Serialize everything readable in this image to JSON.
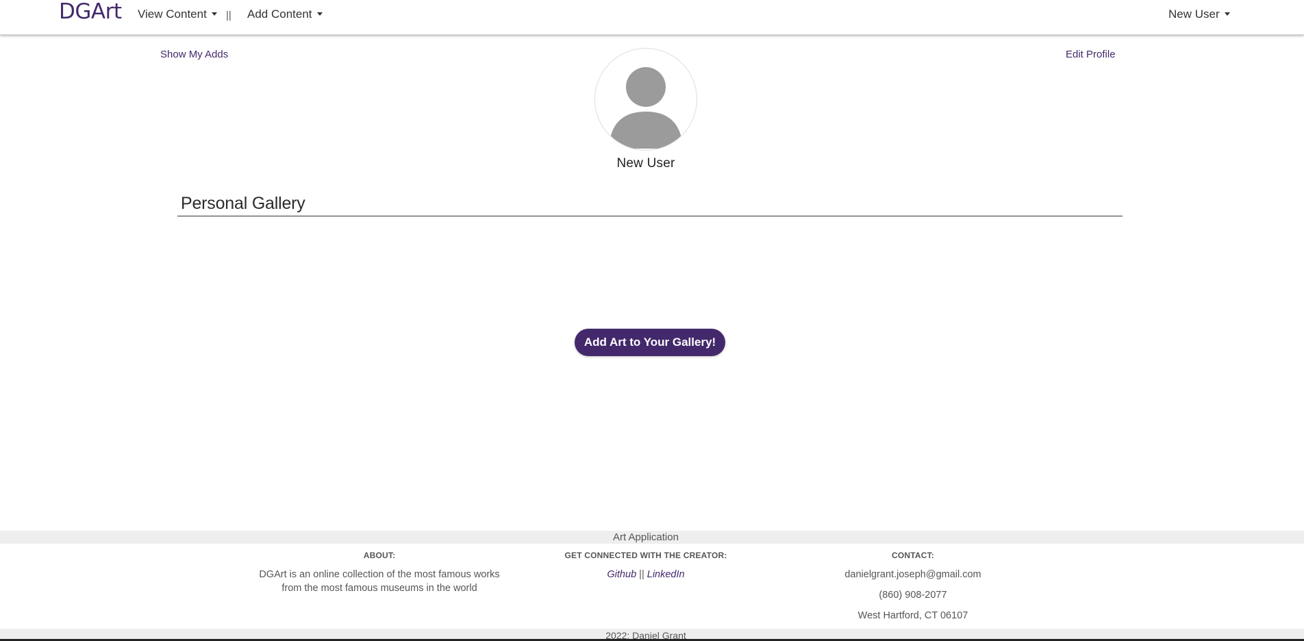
{
  "navbar": {
    "brand": "DGArt",
    "view_content": "View Content",
    "separator": "||",
    "add_content": "Add Content",
    "user_menu": "New User"
  },
  "profile": {
    "show_my_adds": "Show My Adds",
    "edit_profile": "Edit Profile",
    "username": "New User",
    "avatar_icon": "default-user-avatar"
  },
  "gallery": {
    "title": "Personal Gallery",
    "add_button": "Add Art to Your Gallery!"
  },
  "footer": {
    "band_title": "Art Application",
    "about": {
      "heading": "ABOUT:",
      "line1": "DGArt is an online collection of the most famous works",
      "line2": "from the most famous museums in the world"
    },
    "connect": {
      "heading": "GET CONNECTED WITH THE CREATOR:",
      "github": "Github",
      "separator": "||",
      "linkedin": "LinkedIn"
    },
    "contact": {
      "heading": "CONTACT:",
      "email": "danielgrant.joseph@gmail.com",
      "phone": "(860) 908-2077",
      "address": "West Hartford, CT 06107"
    },
    "copyright": "2022: Daniel Grant"
  },
  "colors": {
    "brand": "#43296b",
    "text": "#333333",
    "footer_band": "#eeeeee"
  }
}
